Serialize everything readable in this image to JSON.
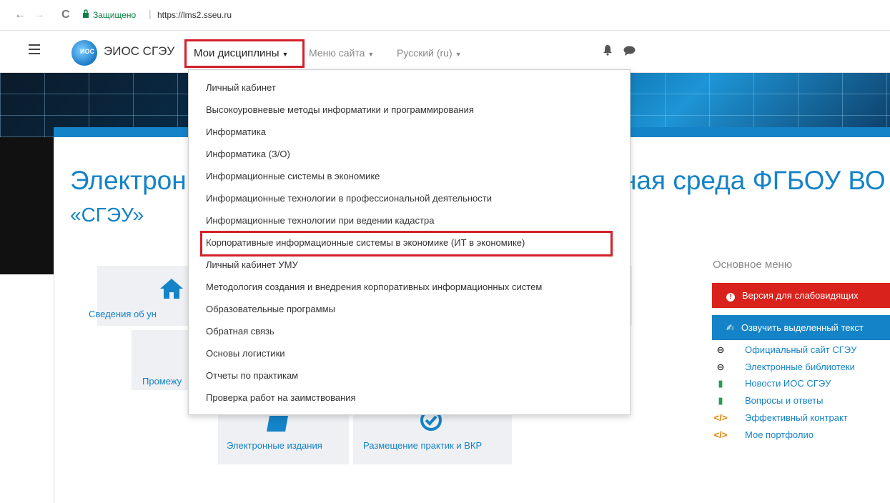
{
  "browser": {
    "back": "←",
    "forward": "→",
    "reload": "C",
    "secure_label": "Защищено",
    "url": "https://lms2.sseu.ru"
  },
  "navbar": {
    "logo_text": "ИОС",
    "site_name": "ЭИОС СГЭУ",
    "my_courses": "Мои дисциплины",
    "site_menu": "Меню сайта",
    "language": "Русский (ru)"
  },
  "page": {
    "title_part1": "Электрони",
    "title_part2": "ная среда ФГБОУ ВО",
    "title_line2": "«СГЭУ»"
  },
  "tiles": {
    "home": "Сведения об ун",
    "exam": "Промежу",
    "edition": "Электронные издания",
    "practice": "Размещение практик и ВКР"
  },
  "sidebar": {
    "title": "Основное меню",
    "vision_button": "Версия для слабовидящих",
    "speak_button": "Озвучить выделенный текст",
    "links": [
      {
        "label": "Официальный сайт СГЭУ",
        "icon": "link-icon"
      },
      {
        "label": "Электронные библиотеки",
        "icon": "link-icon"
      },
      {
        "label": "Новости ИОС СГЭУ",
        "icon": "forum-icon"
      },
      {
        "label": "Вопросы и ответы",
        "icon": "forum-icon"
      },
      {
        "label": "Эффективный контракт",
        "icon": "code-icon"
      },
      {
        "label": "Мое портфолио",
        "icon": "code-icon"
      }
    ]
  },
  "dropdown": {
    "items": [
      "Личный кабинет",
      "Высокоуровневые методы информатики и программирования",
      "Информатика",
      "Информатика (З/О)",
      "Информационные системы в экономике",
      "Информационные технологии в профессиональной деятельности",
      "Информационные технологии при ведении кадастра",
      "Корпоративные информационные системы в экономике (ИТ в экономике)",
      "Личный кабинет УМУ",
      "Методология создания и внедрения корпоративных информационных систем",
      "Образовательные программы",
      "Обратная связь",
      "Основы логистики",
      "Отчеты по практикам",
      "Проверка работ на заимствования"
    ],
    "highlighted_index": 7
  },
  "colors": {
    "accent": "#1583c7",
    "highlight_box": "#d32029",
    "vision_button": "#d9221c"
  }
}
